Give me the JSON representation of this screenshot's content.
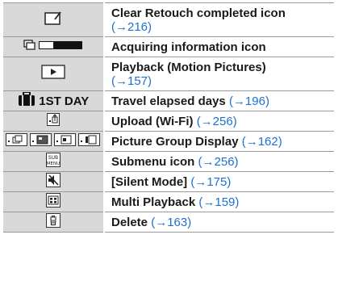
{
  "rows": [
    {
      "icon": "retouch-completed-icon",
      "label": "Clear Retouch completed icon",
      "ref": "(→216)"
    },
    {
      "icon": "acquiring-information-icon",
      "label": "Acquiring information icon",
      "ref": ""
    },
    {
      "icon": "playback-motion-pictures-icon",
      "label": "Playback (Motion Pictures)",
      "ref": "(→157)"
    },
    {
      "icon": "travel-suitcase-icon",
      "icon_text": "1ST DAY",
      "label": "Travel elapsed days",
      "ref": "(→196)"
    },
    {
      "icon": "upload-wifi-icon",
      "label": "Upload (Wi-Fi)",
      "ref": "(→256)"
    },
    {
      "icon": "picture-group-display-icons",
      "label": "Picture Group Display",
      "ref": "(→162)"
    },
    {
      "icon": "submenu-icon",
      "icon_text": "SUB MENU",
      "label": "Submenu icon",
      "ref": "(→256)"
    },
    {
      "icon": "silent-mode-icon",
      "label": "[Silent Mode]",
      "ref": "(→175)"
    },
    {
      "icon": "multi-playback-icon",
      "label": "Multi Playback",
      "ref": "(→159)"
    },
    {
      "icon": "delete-icon",
      "label": "Delete",
      "ref": "(→163)"
    }
  ],
  "colors": {
    "icon_cell_bg": "#d9d9d9",
    "ref_link": "#1f6fd1",
    "border": "#9a9a9a"
  }
}
